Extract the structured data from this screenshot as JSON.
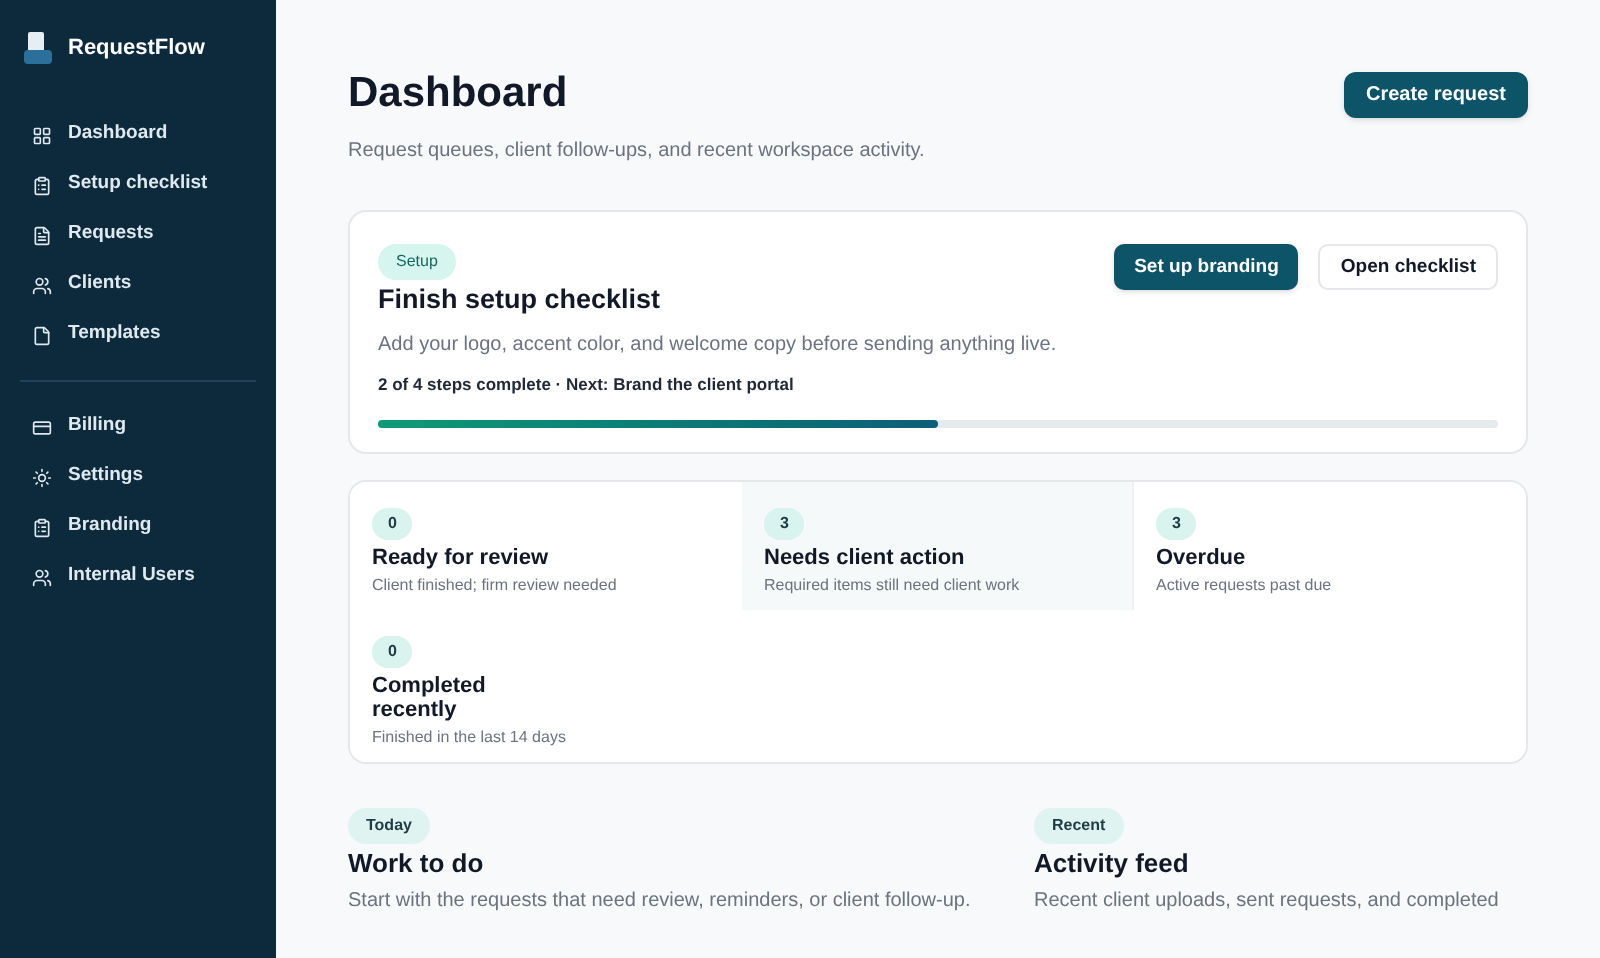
{
  "brand": {
    "name": "RequestFlow"
  },
  "sidebar": {
    "groups": [
      {
        "items": [
          {
            "label": "Dashboard"
          },
          {
            "label": "Setup checklist"
          },
          {
            "label": "Requests"
          },
          {
            "label": "Clients"
          },
          {
            "label": "Templates"
          }
        ]
      },
      {
        "items": [
          {
            "label": "Billing"
          },
          {
            "label": "Settings"
          },
          {
            "label": "Branding"
          },
          {
            "label": "Internal Users"
          }
        ]
      }
    ]
  },
  "header": {
    "title": "Dashboard",
    "subtitle": "Request queues, client follow-ups, and recent workspace activity.",
    "action": "Create request"
  },
  "setup": {
    "badge": "Setup",
    "title": "Finish setup checklist",
    "description": "Add your logo, accent color, and welcome copy before sending anything live.",
    "progress_text": "2 of 4 steps complete · Next: Brand the client portal",
    "level": 0.5,
    "primary_button": "Set up branding",
    "secondary_button": "Open checklist"
  },
  "metrics": [
    {
      "count": "0",
      "title": "Ready for review",
      "description": "Client finished; firm review needed",
      "selected": false
    },
    {
      "count": "3",
      "title": "Needs client action",
      "description": "Required items still need client work",
      "selected": true
    },
    {
      "count": "3",
      "title": "Overdue",
      "description": "Active requests past due",
      "selected": false
    },
    {
      "count": "0",
      "title": "Completed recently",
      "description": "Finished in the last 14 days",
      "selected": false
    }
  ],
  "sections": [
    {
      "badge": "Today",
      "title": "Work to do",
      "description": "Start with the requests that need review, reminders, or client follow-up."
    },
    {
      "badge": "Recent",
      "title": "Activity feed",
      "description": "Recent client uploads, sent requests, and completed"
    }
  ]
}
